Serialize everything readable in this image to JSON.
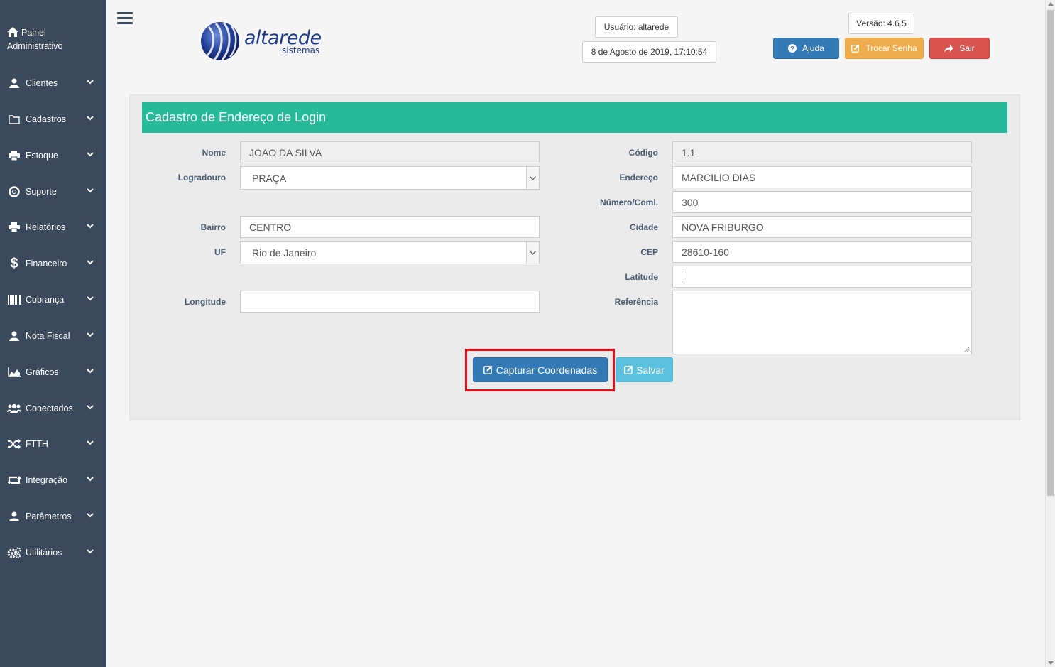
{
  "sidebar": {
    "header": "Painel\nAdministrativo",
    "header_line1": "Painel",
    "header_line2": "Administrativo",
    "items": [
      {
        "label": "Clientes",
        "icon": "user-icon"
      },
      {
        "label": "Cadastros",
        "icon": "folder-icon"
      },
      {
        "label": "Estoque",
        "icon": "printer-icon"
      },
      {
        "label": "Suporte",
        "icon": "lifebuoy-icon"
      },
      {
        "label": "Relatórios",
        "icon": "printer-icon"
      },
      {
        "label": "Financeiro",
        "icon": "dollar-icon"
      },
      {
        "label": "Cobrança",
        "icon": "barcode-icon"
      },
      {
        "label": "Nota Fiscal",
        "icon": "user-icon"
      },
      {
        "label": "Gráficos",
        "icon": "area-chart-icon"
      },
      {
        "label": "Conectados",
        "icon": "users-icon"
      },
      {
        "label": "FTTH",
        "icon": "random-icon"
      },
      {
        "label": "Integração",
        "icon": "retweet-icon"
      },
      {
        "label": "Parâmetros",
        "icon": "user-icon"
      },
      {
        "label": "Utilitários",
        "icon": "cogs-icon"
      }
    ]
  },
  "header": {
    "logo_brand": "altarede",
    "logo_sub": "sistemas",
    "user": "Usuário: altarede",
    "datetime": "8 de Agosto de 2019, 17:10:54",
    "version": "Versão: 4.6.5",
    "help_label": "Ajuda",
    "change_password_label": "Trocar Senha",
    "logout_label": "Sair"
  },
  "form": {
    "title": "Cadastro de Endereço de Login",
    "labels": {
      "nome": "Nome",
      "logradouro": "Logradouro",
      "bairro": "Bairro",
      "uf": "UF",
      "longitude": "Longitude",
      "codigo": "Código",
      "endereco": "Endereço",
      "numero": "Número/Coml.",
      "cidade": "Cidade",
      "cep": "CEP",
      "latitude": "Latitude",
      "referencia": "Referência"
    },
    "values": {
      "nome": "JOAO DA SILVA",
      "logradouro": "PRAÇA",
      "bairro": "CENTRO",
      "uf": "Rio de Janeiro",
      "longitude": "",
      "codigo": "1.1",
      "endereco": "MARCILIO DIAS",
      "numero": "300",
      "cidade": "NOVA FRIBURGO",
      "cep": "28610-160",
      "latitude": "",
      "referencia": ""
    },
    "capture_label": "Capturar Coordenadas",
    "save_label": "Salvar"
  },
  "colors": {
    "sidebar_bg": "#3a4a5c",
    "title_bar": "#26b99a",
    "primary": "#337ab7",
    "warning": "#f0ad4e",
    "danger": "#d9534f",
    "info": "#5bc0de",
    "highlight": "#e0101a"
  }
}
